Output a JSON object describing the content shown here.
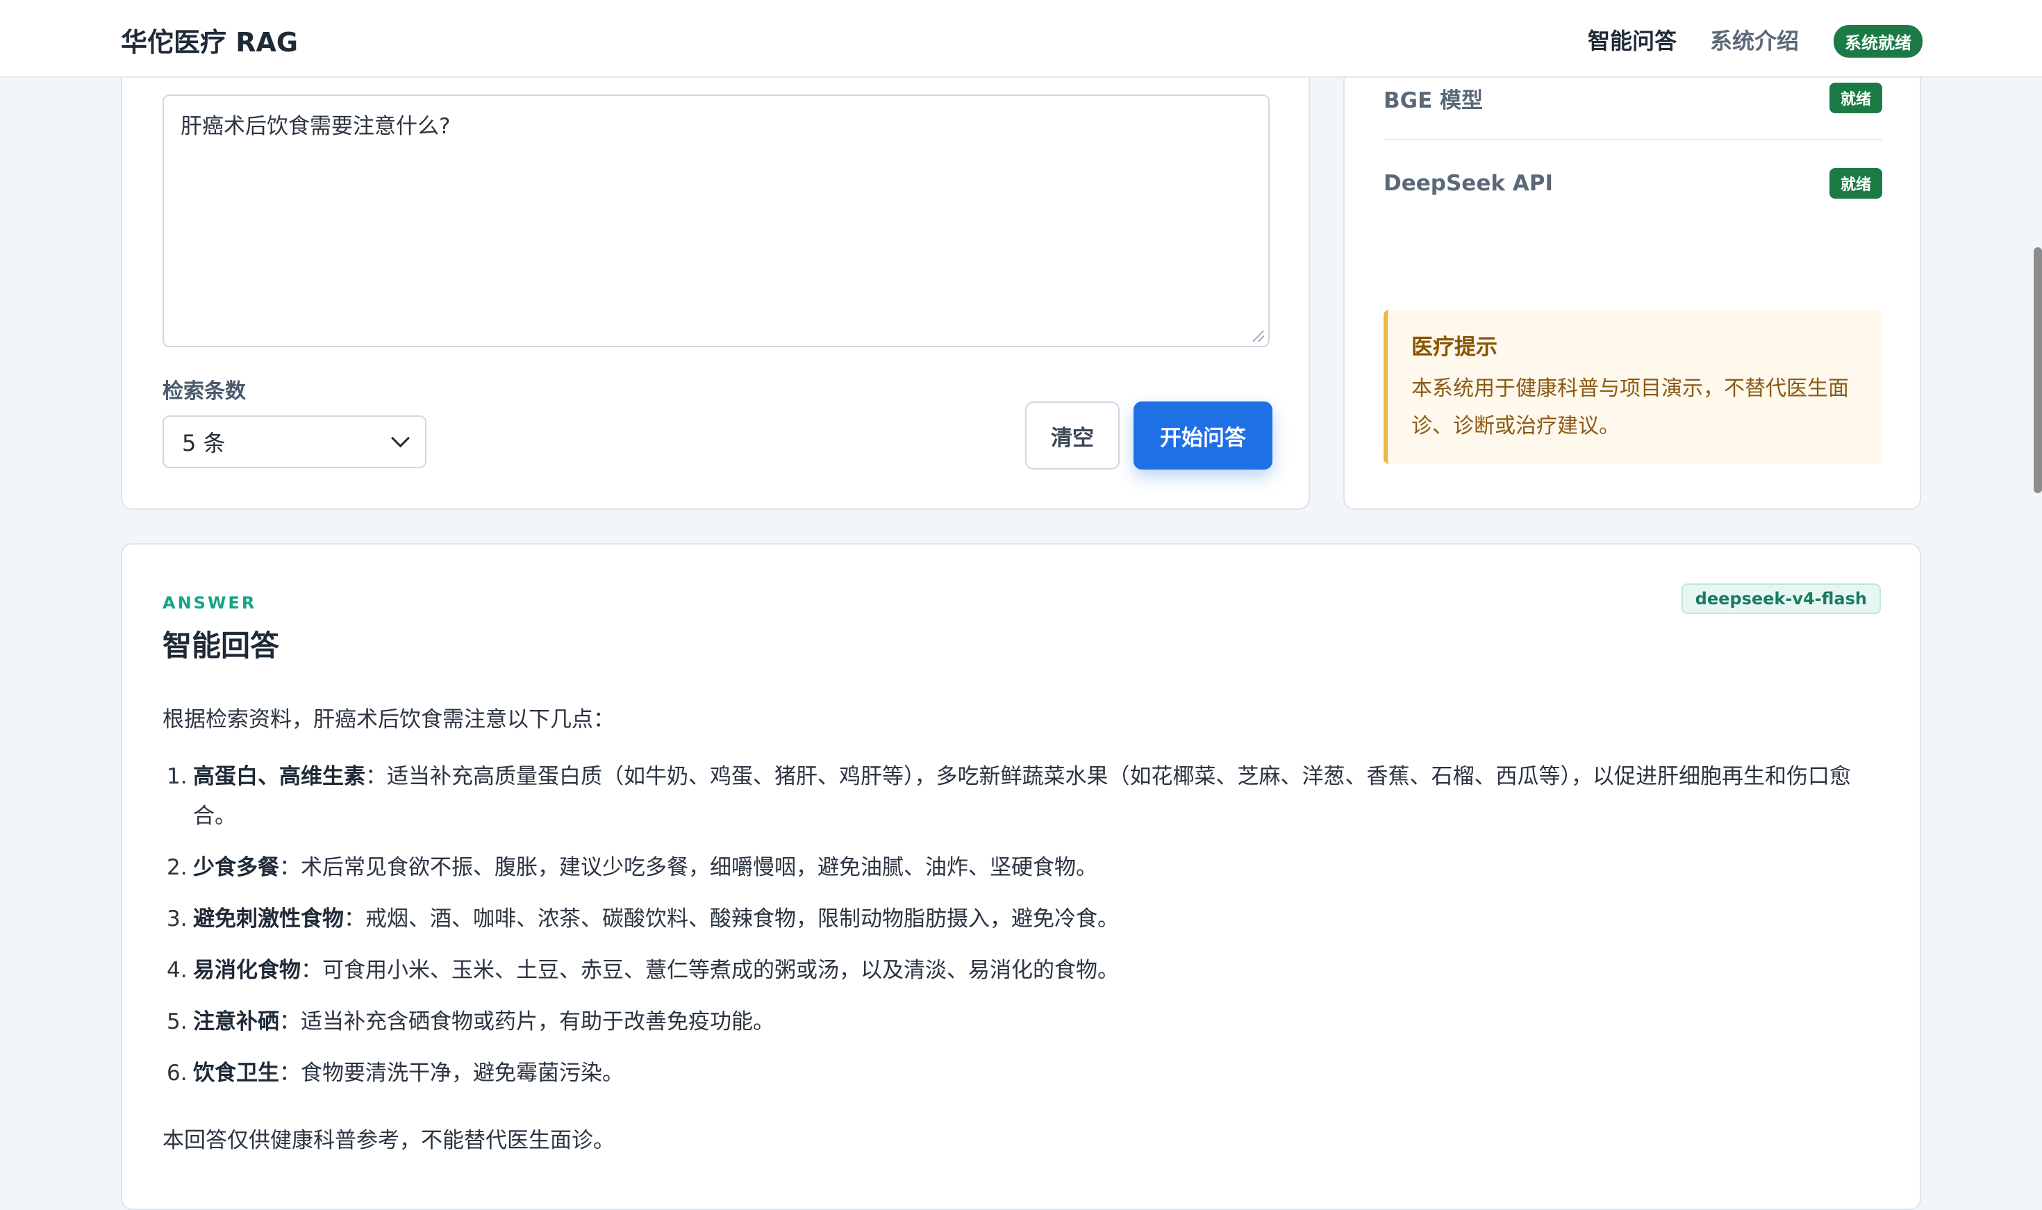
{
  "header": {
    "brand": "华佗医疗 RAG",
    "nav_qa": "智能问答",
    "nav_intro": "系统介绍",
    "status": "系统就绪"
  },
  "ask": {
    "question": "肝癌术后饮食需要注意什么?",
    "count_label": "检索条数",
    "count_value": "5 条",
    "clear_label": "清空",
    "start_label": "开始问答"
  },
  "status_panel": {
    "items": [
      {
        "name": "",
        "badge": "就绪"
      },
      {
        "name": "BGE 模型",
        "badge": "就绪"
      },
      {
        "name": "DeepSeek API",
        "badge": "就绪"
      }
    ],
    "tip_title": "医疗提示",
    "tip_body": "本系统用于健康科普与项目演示，不替代医生面诊、诊断或治疗建议。"
  },
  "answer": {
    "kicker": "ANSWER",
    "title": "智能回答",
    "model": "deepseek-v4-flash",
    "intro": "根据检索资料，肝癌术后饮食需注意以下几点：",
    "items": [
      {
        "num": "1.",
        "head": "高蛋白、高维生素",
        "text": "：适当补充高质量蛋白质（如牛奶、鸡蛋、猪肝、鸡肝等），多吃新鲜蔬菜水果（如花椰菜、芝麻、洋葱、香蕉、石榴、西瓜等），以促进肝细胞再生和伤口愈合。"
      },
      {
        "num": "2.",
        "head": "少食多餐",
        "text": "：术后常见食欲不振、腹胀，建议少吃多餐，细嚼慢咽，避免油腻、油炸、坚硬食物。"
      },
      {
        "num": "3.",
        "head": "避免刺激性食物",
        "text": "：戒烟、酒、咖啡、浓茶、碳酸饮料、酸辣食物，限制动物脂肪摄入，避免冷食。"
      },
      {
        "num": "4.",
        "head": "易消化食物",
        "text": "：可食用小米、玉米、土豆、赤豆、薏仁等煮成的粥或汤，以及清淡、易消化的食物。"
      },
      {
        "num": "5.",
        "head": "注意补硒",
        "text": "：适当补充含硒食物或药片，有助于改善免疫功能。"
      },
      {
        "num": "6.",
        "head": "饮食卫生",
        "text": "：食物要清洗干净，避免霉菌污染。"
      }
    ],
    "note": "本回答仅供健康科普参考，不能替代医生面诊。"
  }
}
